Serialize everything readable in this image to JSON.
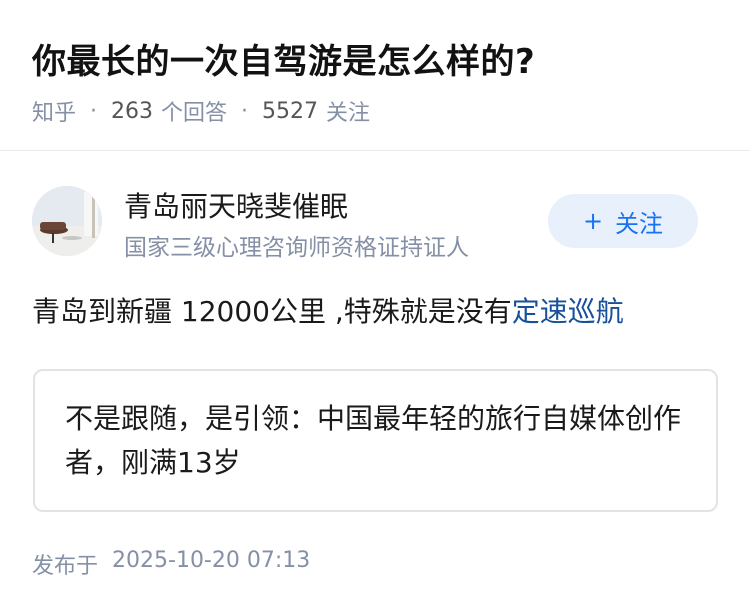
{
  "question": {
    "title": "你最长的一次自驾游是怎么样的?",
    "source": "知乎",
    "answers_count": "263",
    "answers_label": "个回答",
    "followers_count": "5527",
    "followers_label": "关注"
  },
  "author": {
    "name": "青岛丽天晓斐催眠",
    "bio": "国家三级心理咨询师资格证持证人",
    "avatar_icon": "avatar-photo"
  },
  "follow_button": {
    "icon": "+",
    "label": "关注"
  },
  "answer": {
    "text_before": "青岛到新疆 12000公里 ,特殊就是没有",
    "link_text": "定速巡航"
  },
  "card": {
    "text": "不是跟随，是引领：中国最年轻的旅行自媒体创作者，刚满13岁"
  },
  "publish": {
    "label": "发布于",
    "time": "2025-10-20 07:13"
  },
  "colors": {
    "meta_gray": "#8590a6",
    "link_blue": "#175199",
    "follow_blue": "#1772f6",
    "follow_bg": "#e8f0fb"
  }
}
